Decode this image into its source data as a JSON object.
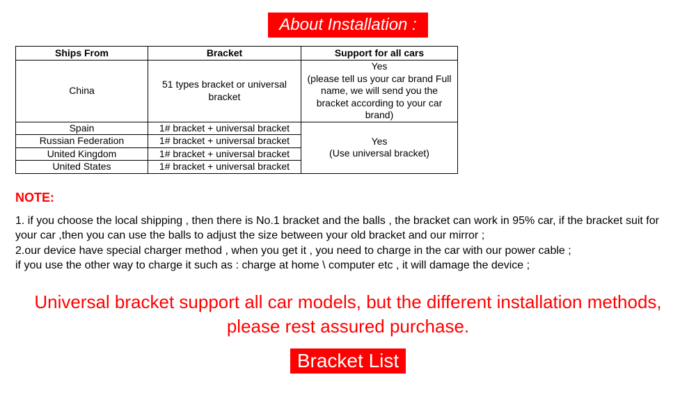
{
  "banner_top": "About Installation :",
  "table": {
    "headers": {
      "ships": "Ships From",
      "bracket": "Bracket",
      "support": "Support for all cars"
    },
    "china": {
      "ships": "China",
      "bracket": "51 types bracket or universal bracket",
      "support": "Yes\n(please tell us your car brand Full name, we will send you the bracket according to your car brand)"
    },
    "rows": [
      {
        "ships": "Spain",
        "bracket": "1# bracket + universal bracket"
      },
      {
        "ships": "Russian Federation",
        "bracket": "1# bracket + universal bracket"
      },
      {
        "ships": "United Kingdom",
        "bracket": "1# bracket + universal bracket"
      },
      {
        "ships": "United States",
        "bracket": "1# bracket + universal bracket"
      }
    ],
    "merged_support": "Yes\n(Use universal bracket)"
  },
  "note": {
    "heading": "NOTE:",
    "body": "1. if you choose the local shipping , then there is No.1 bracket and the balls ,  the bracket can work in 95% car, if the bracket suit for your car ,then you can use the balls to adjust the size between your old bracket and our mirror ;\n2.our device have special charger method , when you get it , you need to charge in  the car with our power cable ;\n if you use the other way to charge it such as : charge at home \\ computer etc , it will damage the device ;"
  },
  "assurance": "Universal bracket support all car models, but the different installation methods, please rest assured purchase.",
  "banner_bottom": "Bracket List"
}
